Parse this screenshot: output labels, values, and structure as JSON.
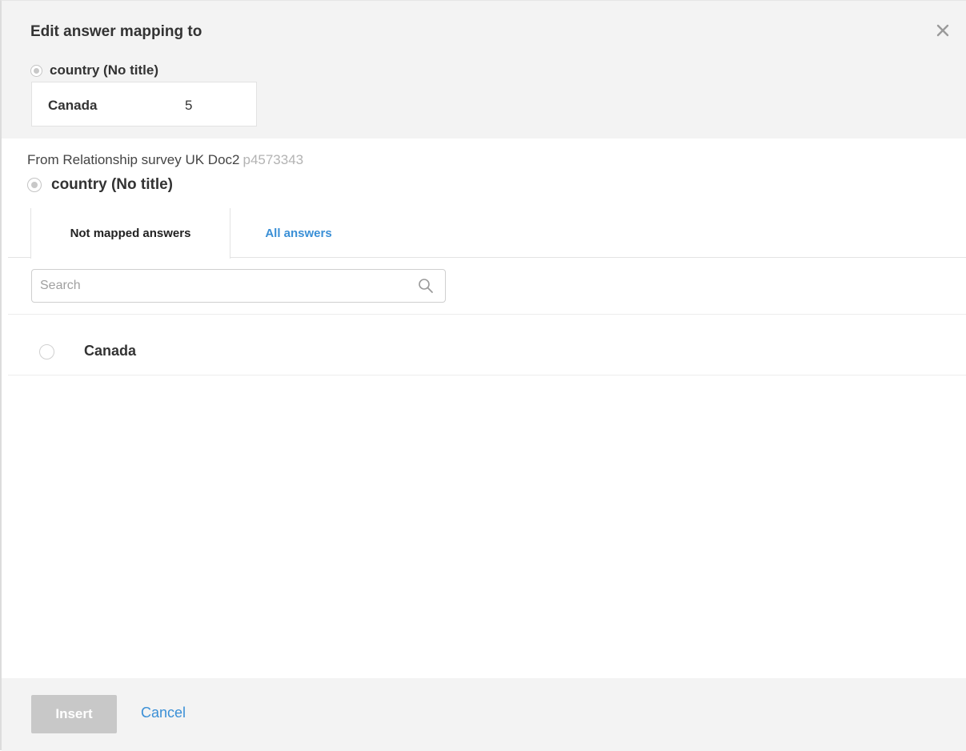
{
  "header": {
    "title": "Edit answer mapping to",
    "close_icon": "close-icon",
    "target_question": "country (No title)",
    "answer": {
      "name": "Canada",
      "code": "5"
    }
  },
  "source": {
    "prefix": "From Relationship survey UK Doc2",
    "doc_id": "p4573343",
    "question": "country (No title)"
  },
  "tabs": [
    {
      "label": "Not mapped answers",
      "active": true
    },
    {
      "label": "All answers",
      "active": false
    }
  ],
  "search": {
    "placeholder": "Search",
    "value": "",
    "icon": "search-icon"
  },
  "answers": [
    {
      "label": "Canada",
      "selected": false
    }
  ],
  "footer": {
    "insert_label": "Insert",
    "cancel_label": "Cancel"
  },
  "colors": {
    "accent": "#3a8fd6",
    "header_bg": "#f3f3f3",
    "disabled_button": "#c8c8c8",
    "muted_text": "#b3b3b3"
  }
}
